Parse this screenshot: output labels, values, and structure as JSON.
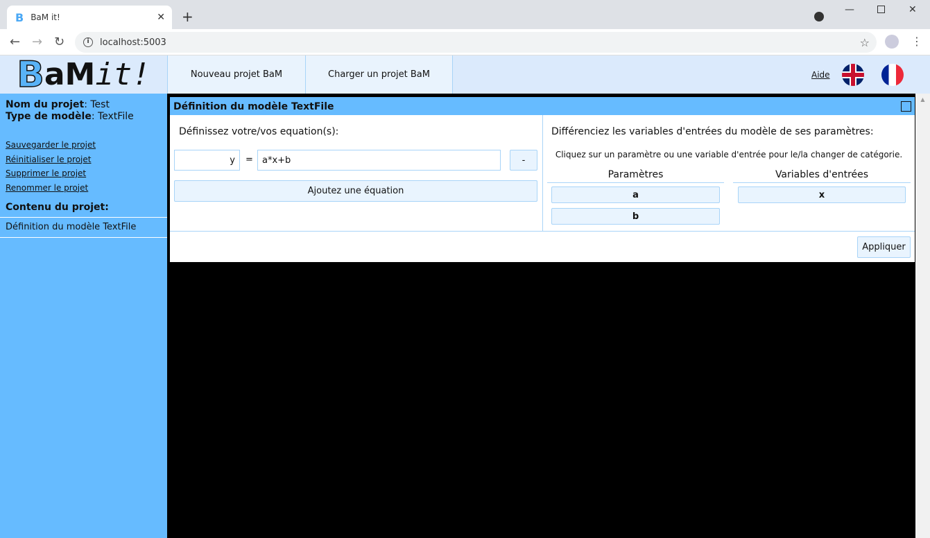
{
  "browser": {
    "tab_title": "BaM it!",
    "url": "localhost:5003"
  },
  "header": {
    "logo": "BaMit!",
    "nav": [
      "Nouveau projet BaM",
      "Charger un projet BaM"
    ],
    "help": "Aide",
    "languages": [
      "English",
      "Français"
    ]
  },
  "sidebar": {
    "project_name_label": "Nom du projet",
    "project_name": "Test",
    "model_type_label": "Type de modèle",
    "model_type": "TextFile",
    "actions": [
      "Sauvegarder le projet",
      "Réinitialiser le projet",
      "Supprimer le projet",
      "Renommer le projet"
    ],
    "content_title": "Contenu du projet:",
    "content_items": [
      "Définition du modèle TextFile"
    ]
  },
  "panel": {
    "title": "Définition du modèle TextFile",
    "equations_label": "Définissez votre/vos equation(s):",
    "equations": [
      {
        "output": "y",
        "eq": "=",
        "formula": "a*x+b",
        "remove": "-"
      }
    ],
    "add_equation": "Ajoutez une équation",
    "diff_label": "Différenciez les variables d'entrées du modèle de ses paramètres:",
    "hint": "Cliquez sur un paramètre ou une variable d'entrée pour le/la changer de catégorie.",
    "params_header": "Paramètres",
    "params": [
      "a",
      "b"
    ],
    "inputs_header": "Variables d'entrées",
    "inputs": [
      "x"
    ],
    "apply": "Appliquer"
  }
}
